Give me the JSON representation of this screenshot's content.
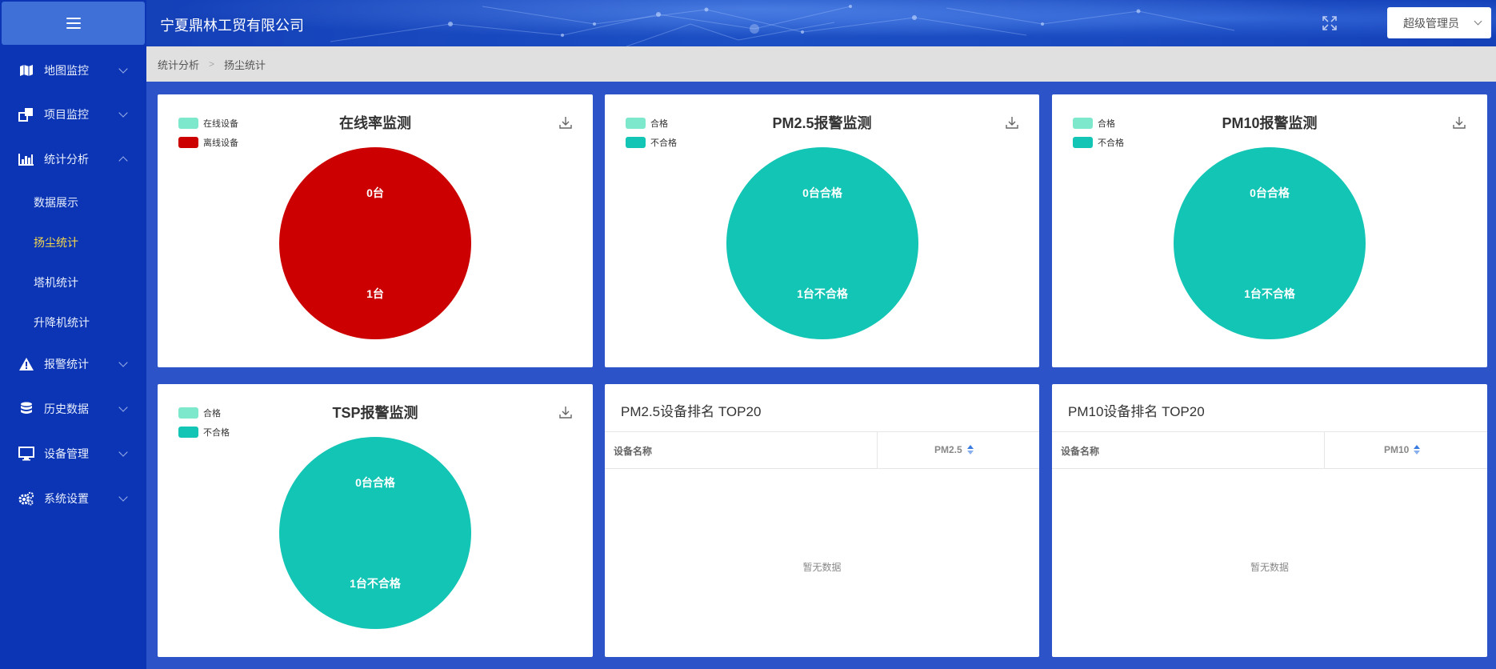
{
  "app": {
    "title": "宁夏鼎林工贸有限公司",
    "user_label": "超级管理员"
  },
  "sidebar": {
    "items": [
      {
        "label": "地图监控",
        "icon": "map-icon"
      },
      {
        "label": "项目监控",
        "icon": "project-icon"
      },
      {
        "label": "统计分析",
        "icon": "bar-chart-icon",
        "expanded": true
      },
      {
        "label": "报警统计",
        "icon": "warning-icon"
      },
      {
        "label": "历史数据",
        "icon": "database-icon"
      },
      {
        "label": "设备管理",
        "icon": "monitor-icon"
      },
      {
        "label": "系统设置",
        "icon": "gears-icon"
      }
    ],
    "sub_items": [
      {
        "label": "数据展示"
      },
      {
        "label": "扬尘统计",
        "active": true
      },
      {
        "label": "塔机统计"
      },
      {
        "label": "升降机统计"
      }
    ]
  },
  "breadcrumb": {
    "parent": "统计分析",
    "current": "扬尘统计",
    "separator": ">"
  },
  "colors": {
    "online": "#7de8cc",
    "offline": "#cc0000",
    "pass": "#7de8cc",
    "fail": "#13c5b4",
    "active_submenu": "#f7d94c"
  },
  "charts": {
    "online": {
      "title": "在线率监测",
      "legend": [
        "在线设备",
        "离线设备"
      ],
      "top_label": "0台",
      "bottom_label": "1台"
    },
    "pm25": {
      "title": "PM2.5报警监测",
      "legend": [
        "合格",
        "不合格"
      ],
      "top_label": "0台合格",
      "bottom_label": "1台不合格"
    },
    "pm10": {
      "title": "PM10报警监测",
      "legend": [
        "合格",
        "不合格"
      ],
      "top_label": "0台合格",
      "bottom_label": "1台不合格"
    },
    "tsp": {
      "title": "TSP报警监测",
      "legend": [
        "合格",
        "不合格"
      ],
      "top_label": "0台合格",
      "bottom_label": "1台不合格"
    }
  },
  "chart_data": [
    {
      "type": "pie",
      "title": "在线率监测",
      "categories": [
        "在线设备",
        "离线设备"
      ],
      "values": [
        0,
        1
      ],
      "legend_position": "top-left"
    },
    {
      "type": "pie",
      "title": "PM2.5报警监测",
      "categories": [
        "合格",
        "不合格"
      ],
      "values": [
        0,
        1
      ],
      "legend_position": "top-left"
    },
    {
      "type": "pie",
      "title": "PM10报警监测",
      "categories": [
        "合格",
        "不合格"
      ],
      "values": [
        0,
        1
      ],
      "legend_position": "top-left"
    },
    {
      "type": "pie",
      "title": "TSP报警监测",
      "categories": [
        "合格",
        "不合格"
      ],
      "values": [
        0,
        1
      ],
      "legend_position": "top-left"
    }
  ],
  "tables": {
    "pm25": {
      "title": "PM2.5设备排名 TOP20",
      "col_name": "设备名称",
      "col_value": "PM2.5",
      "empty": "暂无数据"
    },
    "pm10": {
      "title": "PM10设备排名 TOP20",
      "col_name": "设备名称",
      "col_value": "PM10",
      "empty": "暂无数据"
    }
  }
}
